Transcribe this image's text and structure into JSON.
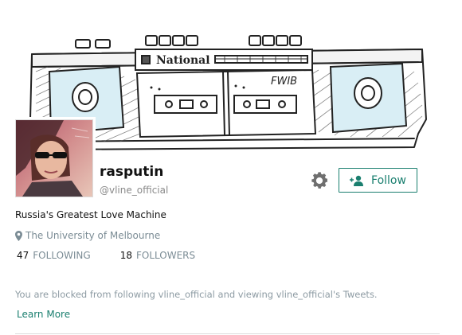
{
  "banner": {
    "brand_text": "National",
    "sticker_text": "FWIB"
  },
  "profile": {
    "display_name": "rasputin",
    "handle": "@vline_official",
    "bio": "Russia's Greatest Love Machine",
    "location": "The University of Melbourne",
    "location_icon": "map-pin-icon",
    "settings_icon": "gear-icon",
    "follow_icon": "person-add-icon",
    "follow_label": "Follow",
    "stats": {
      "following_count": "47",
      "following_label": "FOLLOWING",
      "followers_count": "18",
      "followers_label": "FOLLOWERS"
    },
    "blocked_message": "You are blocked from following vline_official and viewing vline_official's Tweets.",
    "learn_more_label": "Learn More"
  },
  "colors": {
    "accent": "#1a7f6f",
    "muted": "#7b8c95",
    "speaker_fill": "#d9eef5"
  }
}
